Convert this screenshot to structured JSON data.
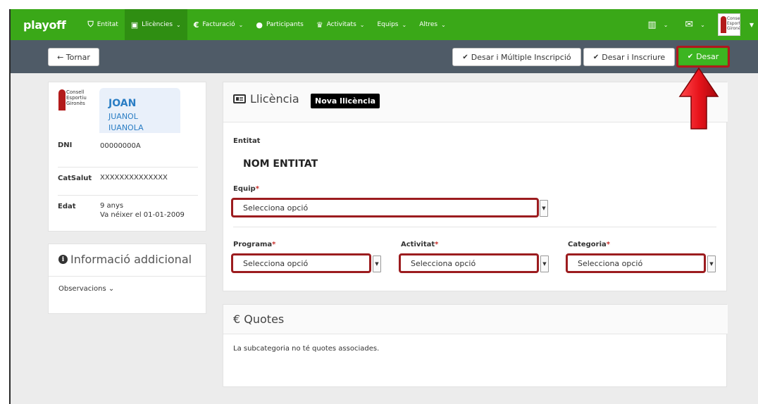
{
  "nav": {
    "brand": "playoff",
    "items": [
      {
        "label": "Entitat",
        "icon": "shield-icon",
        "glyph": "⛉"
      },
      {
        "label": "Llicències",
        "icon": "id-card-icon",
        "glyph": "▣"
      },
      {
        "label": "Facturació",
        "icon": "euro-icon",
        "glyph": "€"
      },
      {
        "label": "Participants",
        "icon": "user-icon",
        "glyph": "●"
      },
      {
        "label": "Activitats",
        "icon": "trophy-icon",
        "glyph": "♛"
      },
      {
        "label": "Equips"
      },
      {
        "label": "Altres"
      }
    ],
    "caret": "⌄",
    "right": {
      "chart_glyph": "▥",
      "mail_glyph": "✉"
    },
    "logo_text": "Consell Esportiu Gironès"
  },
  "toolbar": {
    "back_label": "← Tornar",
    "multi_label": "Desar i Múltiple Inscripció",
    "insc_label": "Desar i Inscriure",
    "save_label": "Desar",
    "check_glyph": "✔"
  },
  "profile": {
    "name": "JOAN",
    "surname1": "JUANOL",
    "surname2": "JUANOLA",
    "fields": [
      {
        "key": "DNI",
        "value": "00000000A"
      },
      {
        "key": "CatSalut",
        "value": "XXXXXXXXXXXXXX"
      },
      {
        "key": "Edat",
        "value": "9 anys",
        "value2": "Va néixer el 01-01-2009"
      }
    ]
  },
  "extra": {
    "title": "Informació addicional",
    "info_glyph": "i",
    "observations": "Observacions ⌄"
  },
  "licence": {
    "title": "Llicència",
    "badge": "Nova llicència",
    "entitat_label": "Entitat",
    "entitat_name": "NOM ENTITAT",
    "equip_label": "Equip",
    "programa_label": "Programa",
    "activitat_label": "Activitat",
    "categoria_label": "Categoria",
    "required_mark": "*",
    "placeholder": "Selecciona opció",
    "arrow_glyph": "▼"
  },
  "quotes": {
    "title": "€ Quotes",
    "text": "La subcategoria no té quotes associades."
  },
  "colors": {
    "nav_green": "#3aa818",
    "toolbar_gray": "#4f5b67",
    "highlight_red": "#9c1c1f",
    "arrow_red": "#e8141b"
  }
}
